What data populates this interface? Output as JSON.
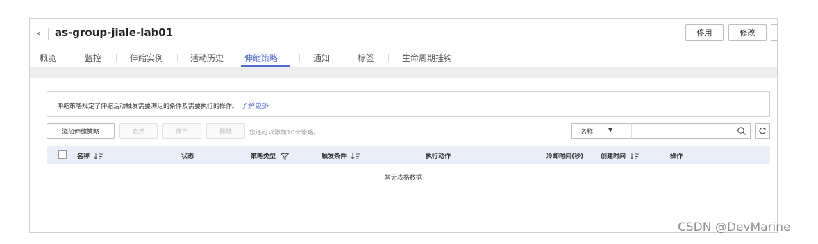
{
  "header": {
    "title": "as-group-jiale-lab01",
    "stop_label": "停用",
    "edit_label": "修改"
  },
  "tabs": [
    {
      "label": "概览"
    },
    {
      "label": "监控"
    },
    {
      "label": "伸缩实例"
    },
    {
      "label": "活动历史"
    },
    {
      "label": "伸缩策略",
      "active": true
    },
    {
      "label": "通知"
    },
    {
      "label": "标签"
    },
    {
      "label": "生命周期挂钩"
    }
  ],
  "info": {
    "text": "伸缩策略规定了伸缩活动触发需要满足的条件及需要执行的操作。",
    "link": "了解更多"
  },
  "toolbar": {
    "add": "添加伸缩策略",
    "enable": "启用",
    "disable": "停用",
    "delete": "删除",
    "hint": "您还可以添加10个策略。",
    "search_field": "名称"
  },
  "table": {
    "columns": [
      "名称",
      "状态",
      "策略类型",
      "触发条件",
      "执行动作",
      "冷却时间(秒)",
      "创建时间",
      "操作"
    ],
    "empty_text": "暂无表格数据"
  },
  "watermark": "CSDN @DevMarine",
  "colors": {
    "accent": "#526ecc",
    "table_header": "#e9eef8"
  }
}
